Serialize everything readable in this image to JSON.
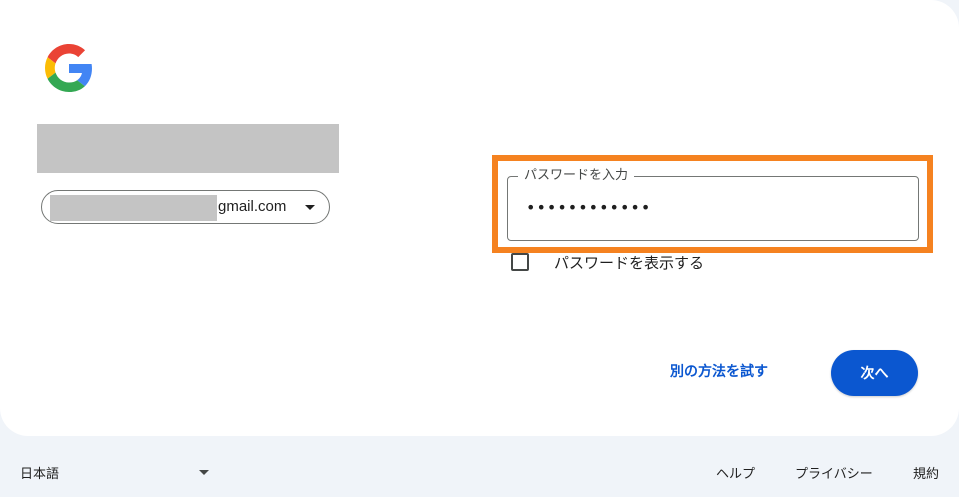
{
  "logo": {
    "icon": "google-g-icon",
    "colors": [
      "#4285F4",
      "#EA4335",
      "#FBBC05",
      "#34A853"
    ]
  },
  "account": {
    "email_suffix": "gmail.com",
    "chevron_icon": "chevron-down-icon"
  },
  "password": {
    "label": "パスワードを入力",
    "value": "••••••••••••"
  },
  "show_password": {
    "label": "パスワードを表示する",
    "checked": false
  },
  "actions": {
    "try_another": "別の方法を試す",
    "next": "次へ"
  },
  "footer": {
    "language": "日本語",
    "links": {
      "help": "ヘルプ",
      "privacy": "プライバシー",
      "terms": "規約"
    }
  },
  "colors": {
    "accent": "#0b57d0",
    "highlight": "#f58220",
    "background": "#f0f4f9"
  }
}
